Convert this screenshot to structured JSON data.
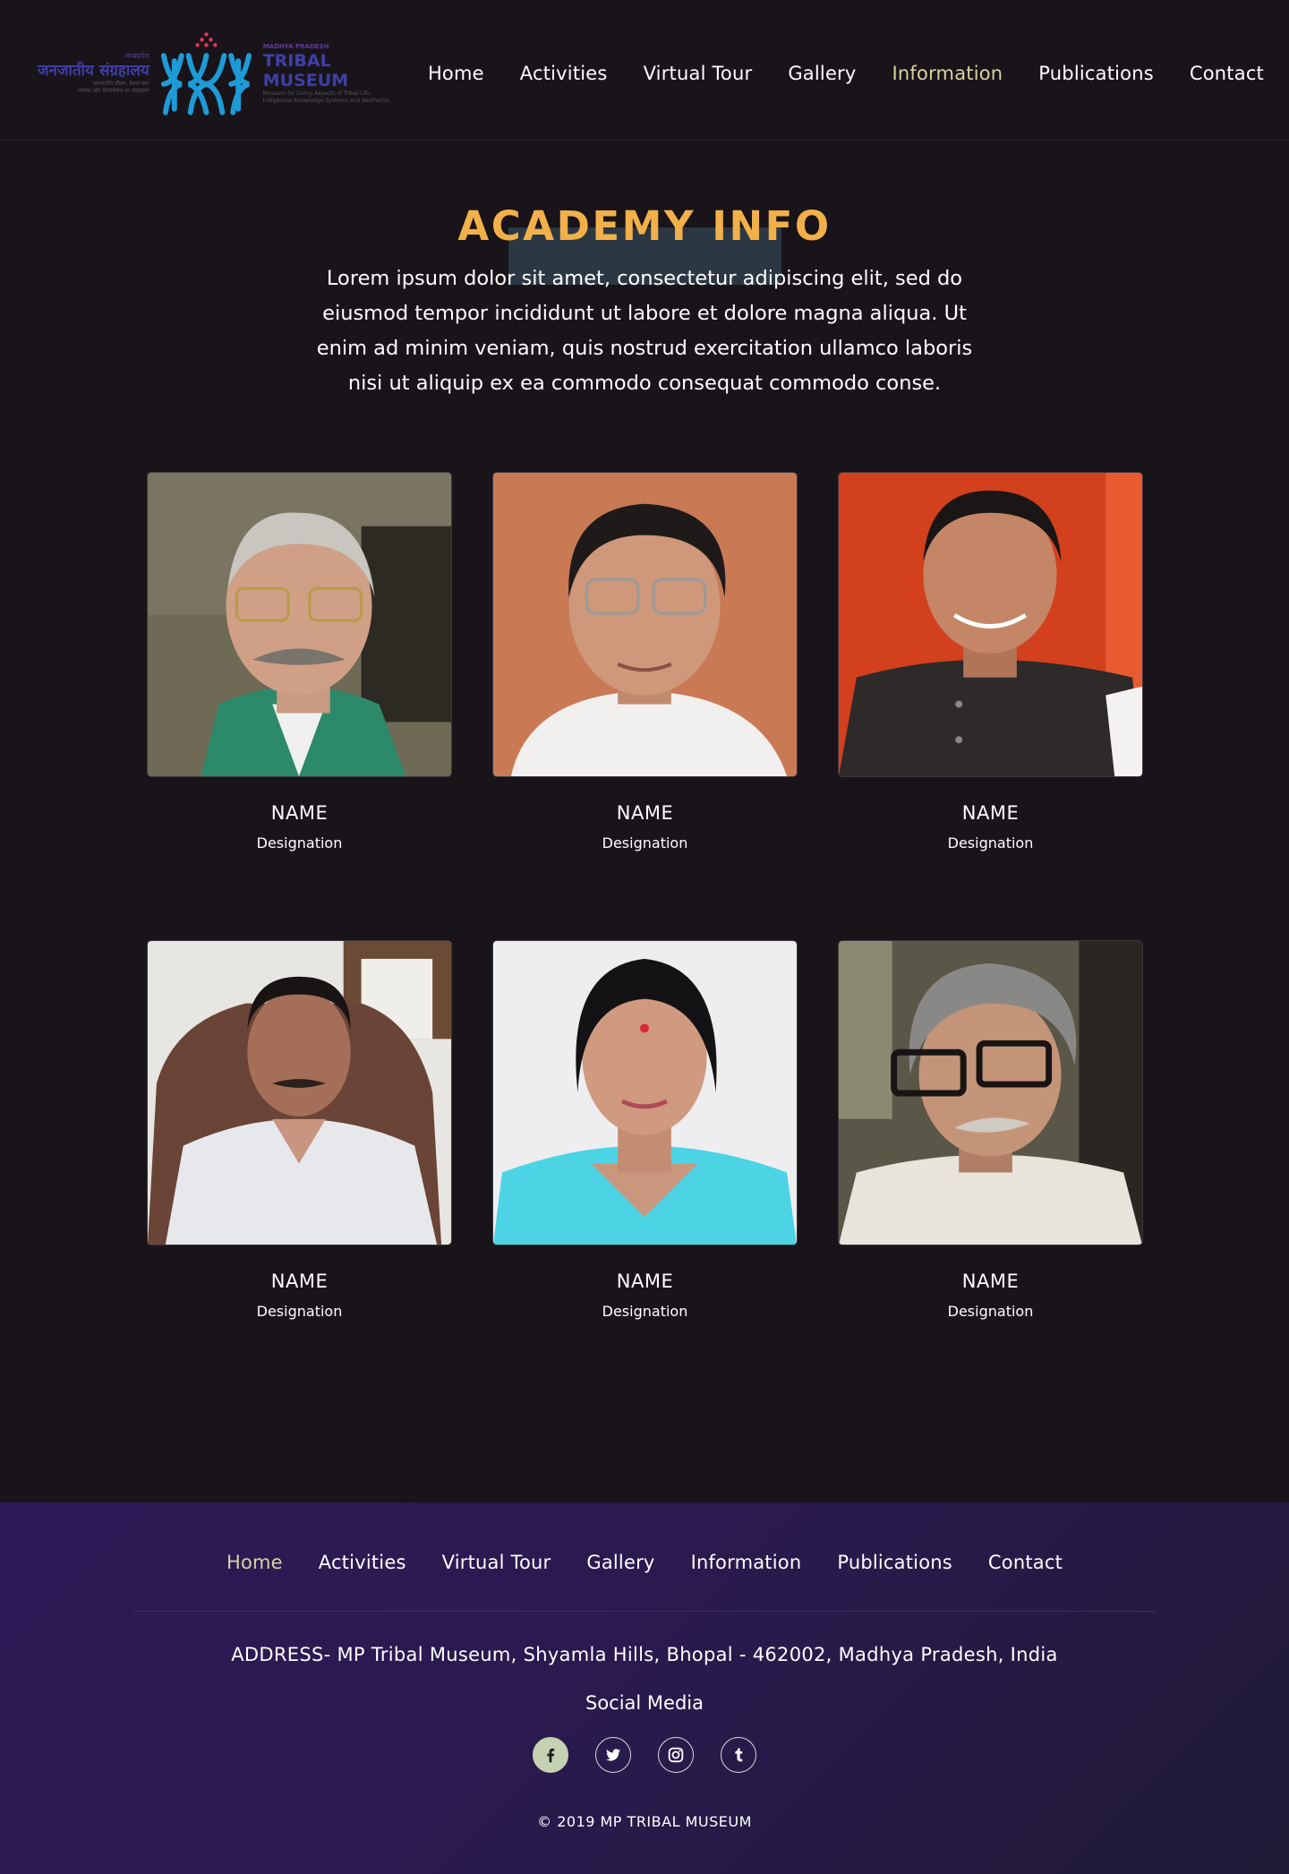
{
  "header": {
    "logo": {
      "hindi_top": "मध्यप्रदेश",
      "hindi_title": "जनजातीय संग्रहालय",
      "hindi_sub1": "जनजातीय जीवन, देशज ज्ञान",
      "hindi_sub2": "परम्परा और सौन्दर्यबोध का संग्रहालय",
      "en_top": "MADHYA PRADESH",
      "en_title": "TRIBAL MUSEUM",
      "en_sub1": "Museum for Living Aspects of Tribal Life,",
      "en_sub2": "Indigenous Knowledge Systems and Aesthetics"
    },
    "nav": [
      {
        "label": "Home",
        "active": false
      },
      {
        "label": "Activities",
        "active": false
      },
      {
        "label": "Virtual Tour",
        "active": false
      },
      {
        "label": "Gallery",
        "active": false
      },
      {
        "label": "Information",
        "active": true
      },
      {
        "label": "Publications",
        "active": false
      },
      {
        "label": "Contact",
        "active": false
      }
    ]
  },
  "hero": {
    "title": "ACADEMY INFO",
    "intro": "Lorem ipsum dolor sit amet, consectetur adipiscing elit, sed do eiusmod tempor incididunt ut labore et dolore magna aliqua. Ut enim ad minim veniam, quis nostrud exercitation ullamco laboris nisi ut aliquip ex ea commodo consequat commodo conse."
  },
  "team": [
    {
      "name": "NAME",
      "designation": "Designation"
    },
    {
      "name": "NAME",
      "designation": "Designation"
    },
    {
      "name": "NAME",
      "designation": "Designation"
    },
    {
      "name": "NAME",
      "designation": "Designation"
    },
    {
      "name": "NAME",
      "designation": "Designation"
    },
    {
      "name": "NAME",
      "designation": "Designation"
    }
  ],
  "footer": {
    "nav": [
      {
        "label": "Home",
        "active": true
      },
      {
        "label": "Activities",
        "active": false
      },
      {
        "label": "Virtual Tour",
        "active": false
      },
      {
        "label": "Gallery",
        "active": false
      },
      {
        "label": "Information",
        "active": false
      },
      {
        "label": "Publications",
        "active": false
      },
      {
        "label": "Contact",
        "active": false
      }
    ],
    "address": "ADDRESS- MP Tribal Museum, Shyamla Hills, Bhopal - 462002, Madhya Pradesh, India",
    "social_title": "Social Media",
    "social": [
      "facebook-icon",
      "twitter-icon",
      "instagram-icon",
      "tumblr-icon"
    ],
    "copyright": "© 2019 MP TRIBAL MUSEUM"
  },
  "colors": {
    "background": "#19141a",
    "accent_title": "#f2b04a",
    "nav_active": "#d8d3a2",
    "logo_blue": "#1e9bd7",
    "footer_purple": "#2e1a57"
  }
}
